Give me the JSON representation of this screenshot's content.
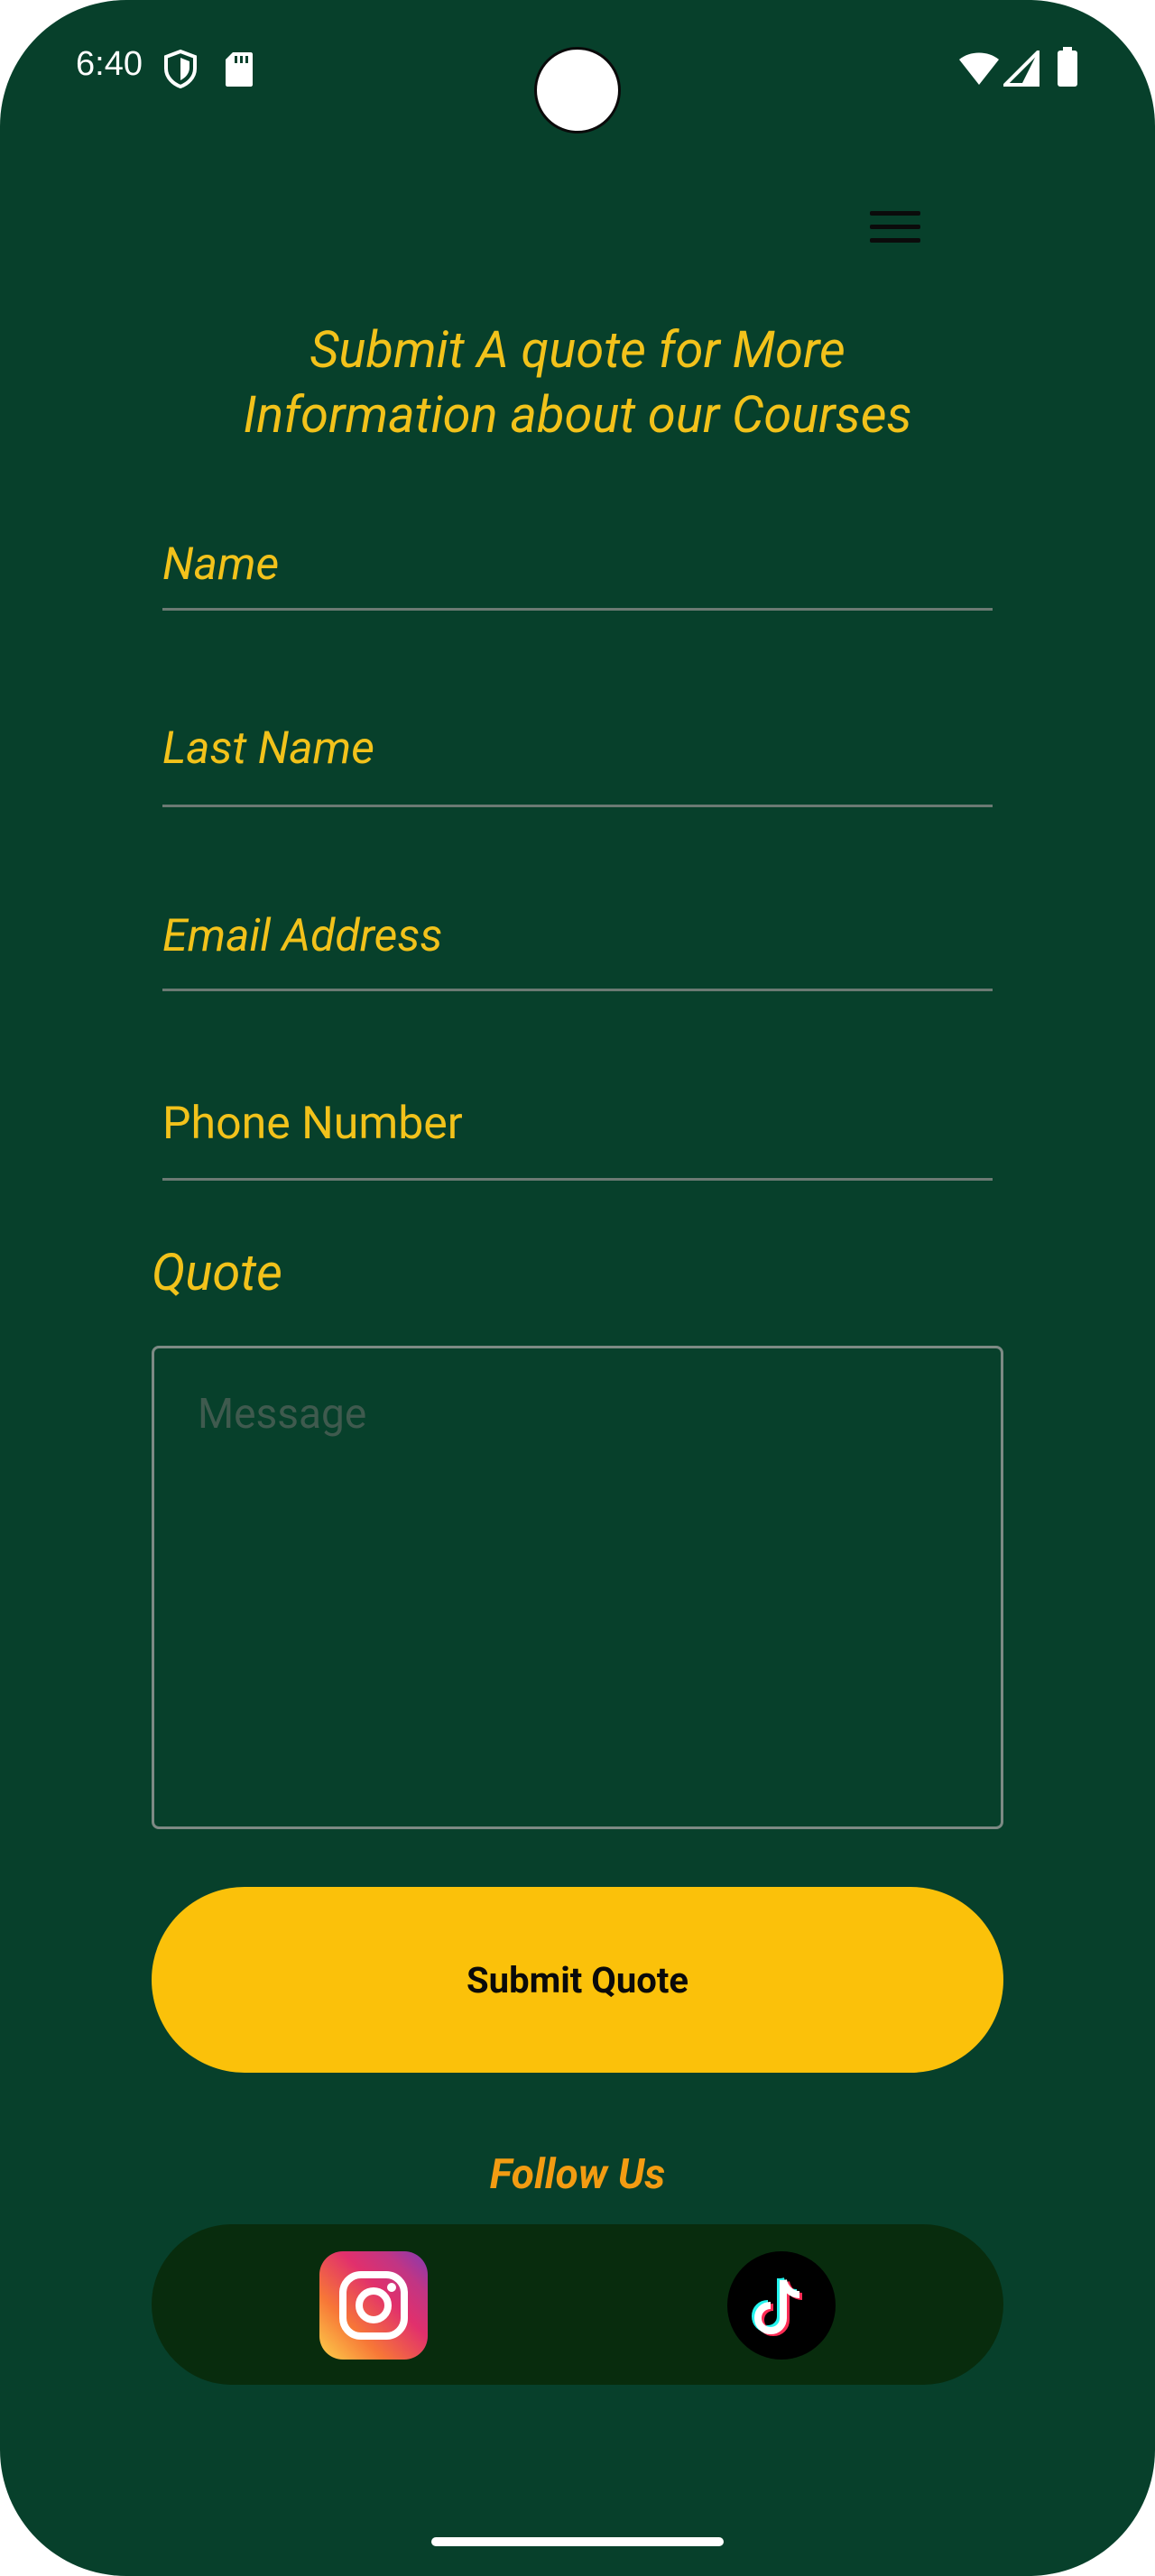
{
  "status_bar": {
    "time": "6:40"
  },
  "header": {
    "menu_icon": "hamburger-menu-icon"
  },
  "form": {
    "heading_line1": "Submit A quote for More",
    "heading_line2": "Information about our Courses",
    "name_label": "Name",
    "last_name_label": "Last Name",
    "email_label": "Email Address",
    "phone_label": "Phone Number",
    "quote_label": "Quote",
    "message_placeholder": "Message",
    "submit_label": "Submit Quote"
  },
  "social": {
    "follow_label": "Follow Us",
    "icons": [
      "instagram-icon",
      "tiktok-icon"
    ]
  },
  "colors": {
    "background": "#07402b",
    "accent_text": "#f2c21b",
    "button": "#fbc10a",
    "follow": "#f39c12",
    "social_bar": "#082c0d"
  }
}
